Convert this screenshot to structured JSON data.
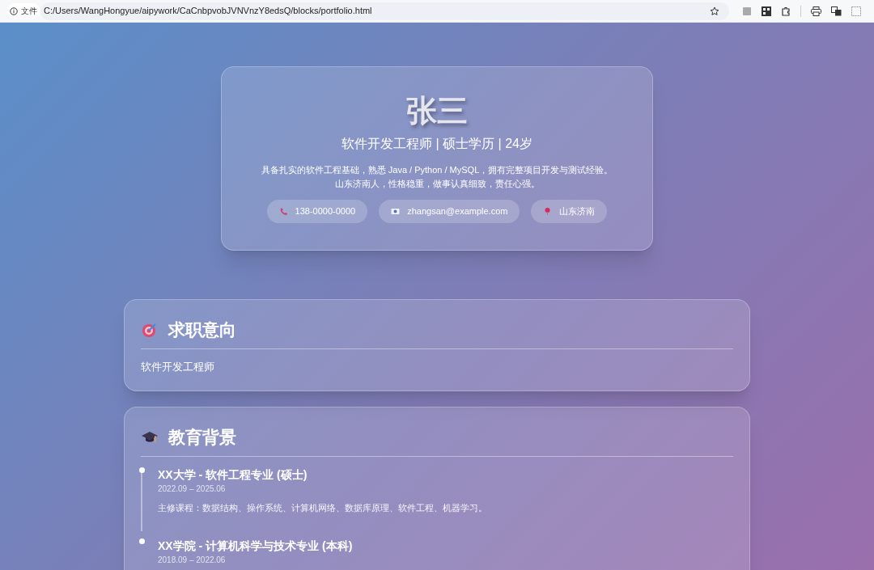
{
  "browser": {
    "security_label": "文件",
    "url": "C:/Users/WangHongyue/aipywork/CaCnbpvobJVNVnzY8edsQ/blocks/portfolio.html"
  },
  "header": {
    "name": "张三",
    "subtitle": "软件开发工程师 | 硕士学历 | 24岁",
    "intro": [
      "具备扎实的软件工程基础，熟悉 Java / Python / MySQL，拥有完整项目开发与测试经验。",
      "山东济南人，性格稳重，做事认真细致，责任心强。"
    ],
    "contacts": [
      {
        "kind": "phone",
        "text": "138-0000-0000"
      },
      {
        "kind": "email",
        "text": "zhangsan@example.com"
      },
      {
        "kind": "location",
        "text": "山东济南"
      }
    ]
  },
  "sections": [
    {
      "kind": "target",
      "title": "求职意向",
      "text": "软件开发工程师"
    },
    {
      "kind": "education",
      "title": "教育背景",
      "entries": [
        {
          "title": "XX大学 - 软件工程专业 (硕士)",
          "period": "2022.09 – 2025.06",
          "detail": "主修课程：数据结构、操作系统、计算机网络、数据库原理、软件工程、机器学习。"
        },
        {
          "title": "XX学院 - 计算机科学与技术专业 (本科)",
          "period": "2018.09 – 2022.06"
        }
      ]
    }
  ]
}
